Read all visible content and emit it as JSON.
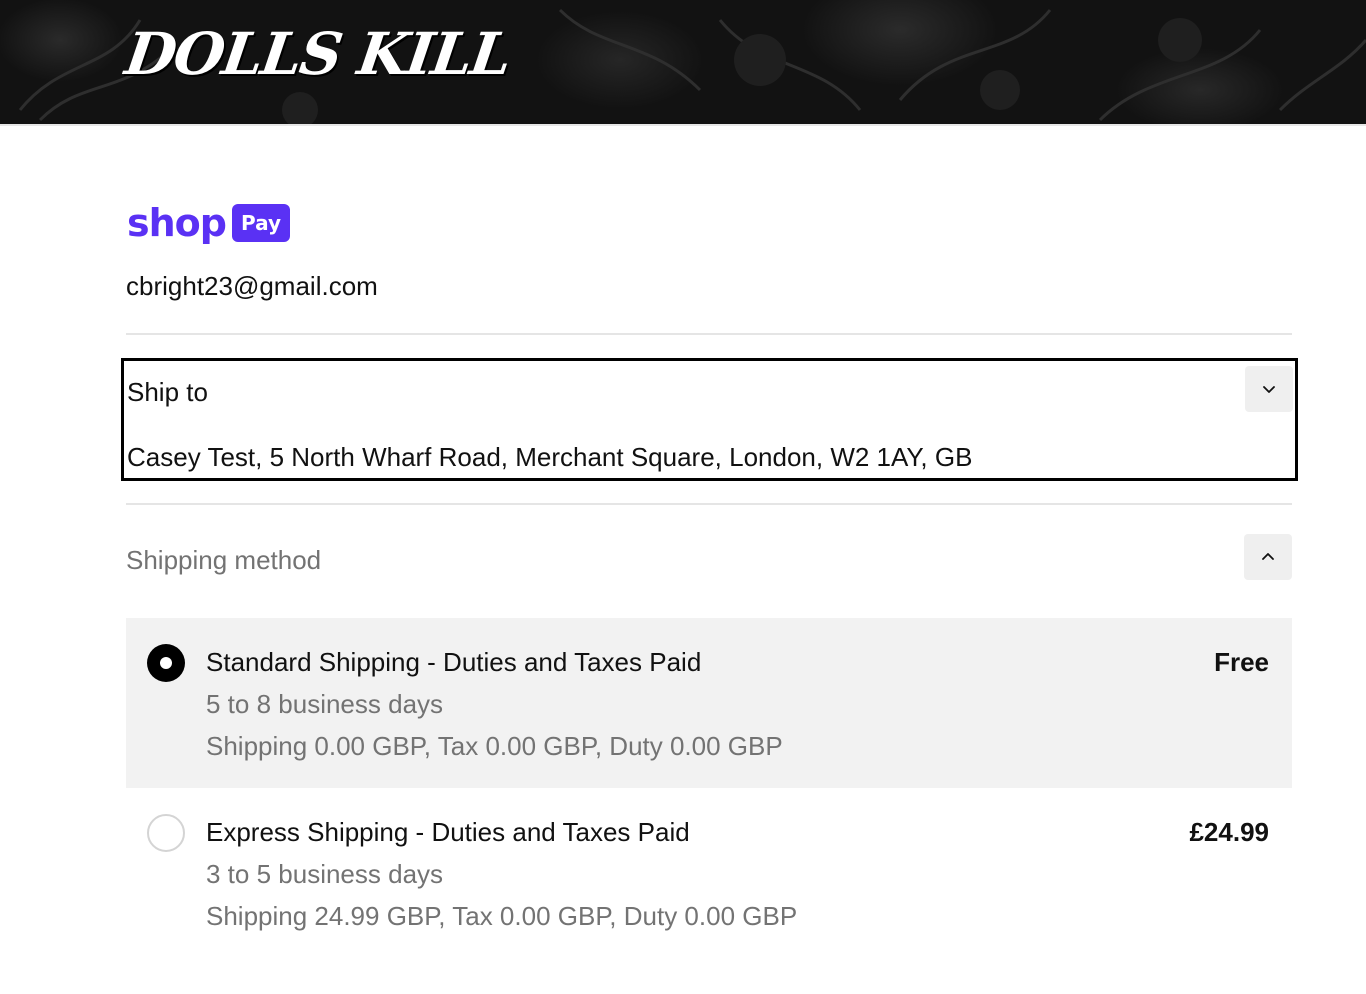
{
  "header": {
    "brand": "DOLLS KILL"
  },
  "shop_pay": {
    "shop_word": "shop",
    "pay_badge": "Pay"
  },
  "account": {
    "email": "cbright23@gmail.com"
  },
  "ship_to": {
    "label": "Ship to",
    "address": "Casey Test, 5 North Wharf Road, Merchant Square, London, W2 1AY, GB",
    "toggle_icon": "chevron-down-icon"
  },
  "shipping_method": {
    "title": "Shipping method",
    "toggle_icon": "chevron-up-icon",
    "options": [
      {
        "title": "Standard Shipping - Duties and Taxes Paid",
        "days": "5 to 8 business days",
        "breakdown": "Shipping 0.00 GBP, Tax 0.00 GBP, Duty 0.00 GBP",
        "price": "Free",
        "selected": true
      },
      {
        "title": "Express Shipping - Duties and Taxes Paid",
        "days": "3 to 5 business days",
        "breakdown": "Shipping 24.99 GBP, Tax 0.00 GBP, Duty 0.00 GBP",
        "price": "£24.99",
        "selected": false
      }
    ]
  },
  "colors": {
    "shop_pay_purple": "#5a31f4",
    "selected_option_bg": "#f2f2f2",
    "muted_text": "#737373"
  }
}
